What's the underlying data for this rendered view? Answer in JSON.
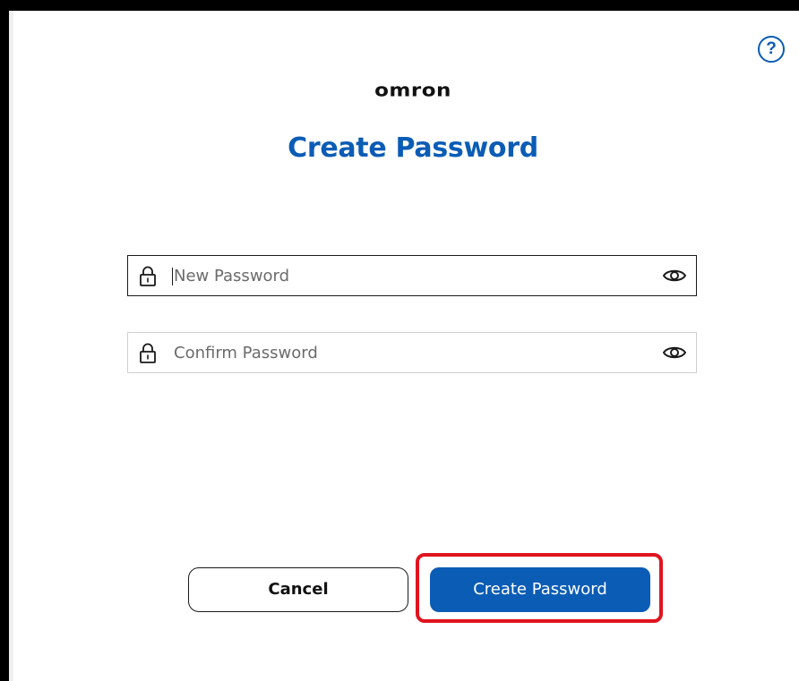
{
  "help": {
    "glyph": "?",
    "icon": "help-circle-icon"
  },
  "brand": {
    "logo_text": "omron"
  },
  "page": {
    "title": "Create Password"
  },
  "form": {
    "new_password": {
      "placeholder": "New Password",
      "value": ""
    },
    "confirm_password": {
      "placeholder": "Confirm Password",
      "value": ""
    }
  },
  "actions": {
    "cancel_label": "Cancel",
    "create_label": "Create Password"
  },
  "colors": {
    "accent": "#0b5cb5",
    "highlight": "#e0141f",
    "text": "#111111"
  }
}
